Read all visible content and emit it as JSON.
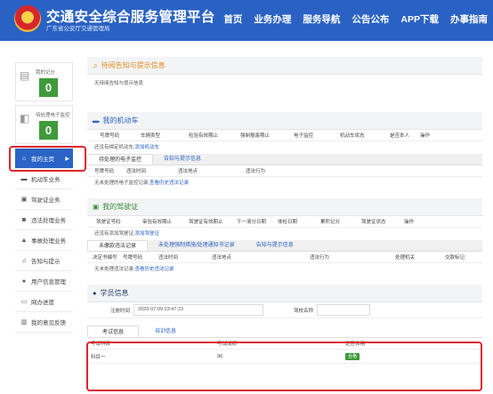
{
  "header": {
    "title": "交通安全综合服务管理平台",
    "subtitle": "广东省公安厅交通管理局",
    "nav": [
      "首页",
      "业务办理",
      "服务导航",
      "公告公布",
      "APP下载",
      "办事指南"
    ]
  },
  "sidebar": {
    "cards": [
      {
        "label": "我的记分",
        "value": "0",
        "icon": "document-icon"
      },
      {
        "label": "待处理电子监控",
        "value": "0",
        "icon": "camera-icon"
      }
    ],
    "items": [
      {
        "label": "我的主页",
        "icon": "home-icon",
        "active": true
      },
      {
        "label": "机动车业务",
        "icon": "car-icon"
      },
      {
        "label": "驾驶证业务",
        "icon": "license-icon"
      },
      {
        "label": "违法处理业务",
        "icon": "camera-icon"
      },
      {
        "label": "事故处理业务",
        "icon": "warning-icon"
      },
      {
        "label": "告知与提示",
        "icon": "bell-icon"
      },
      {
        "label": "用户信息管理",
        "icon": "user-icon"
      },
      {
        "label": "网办进度",
        "icon": "progress-icon"
      },
      {
        "label": "我的意见反馈",
        "icon": "feedback-icon"
      }
    ]
  },
  "notice": {
    "title": "待阅告知与提示信息",
    "text": "无待阅告知与提示信息"
  },
  "vehicle": {
    "title": "我的机动车",
    "columns": [
      "号牌号码",
      "车辆类型",
      "检验有效期止",
      "强制报废期止",
      "电子监控",
      "机动车状态",
      "是否本人",
      "操作"
    ],
    "empty_text": "还没有绑定机动车,",
    "empty_link": "添加机动车",
    "tabs": [
      "待处理的电子监控",
      "告知与提示信息"
    ],
    "sub_columns": [
      "号牌号码",
      "违法时间",
      "违法地点",
      "违法行为"
    ],
    "sub_empty": "无未处理的电子监控记录,",
    "sub_link": "查看历史违法记录"
  },
  "license": {
    "title": "我的驾驶证",
    "columns": [
      "驾驶证号码",
      "审验有效期止",
      "驾驶证有效期止",
      "下一清分日期",
      "体检日期",
      "累积记分",
      "驾驶证状态",
      "操作"
    ],
    "empty_text": "还没有添加驾驶证,",
    "empty_link": "添加驾驶证",
    "tabs": [
      "未缴款违法记录",
      "未处理强制措施/处理通知书记录",
      "告知与提示信息"
    ],
    "sub_columns": [
      "决定书编号",
      "号牌号码",
      "违法时间",
      "违法地点",
      "违法行为",
      "处理机关",
      "交款标记"
    ],
    "sub_empty": "无未处理违法记录,",
    "sub_link": "查看历史违法记录"
  },
  "student": {
    "title": "学员信息",
    "reg_label": "注册时间",
    "reg_value": "2023-07-09 23:47:23",
    "school_label": "驾校名称",
    "school_value": "",
    "tabs": [
      "考试信息",
      "培训信息"
    ],
    "exam_columns": [
      "考试科目",
      "考试成绩",
      "是否合格"
    ],
    "exam_rows": [
      {
        "subject": "科目一",
        "score": "96",
        "passed": "合格"
      }
    ]
  },
  "colors": {
    "header_blue": "#2a62c4",
    "green": "#3f9a3a",
    "highlight_red": "#e0242b",
    "notice_orange": "#e08a1e"
  }
}
